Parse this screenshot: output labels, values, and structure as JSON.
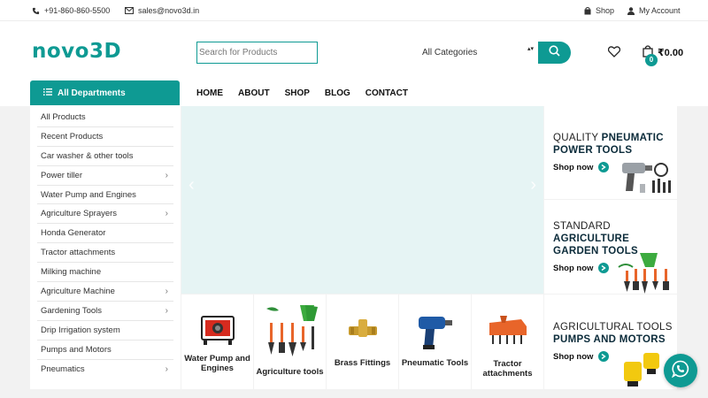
{
  "topbar": {
    "phone": "+91-860-860-5500",
    "email": "sales@novo3d.in",
    "shop_label": "Shop",
    "account_label": "My Account"
  },
  "header": {
    "logo": "novo3D",
    "search_placeholder": "Search for Products",
    "category_selected": "All Categories",
    "cart_count": "0",
    "cart_total": "₹0.00"
  },
  "nav": {
    "departments_label": "All Departments",
    "links": [
      "HOME",
      "ABOUT",
      "SHOP",
      "BLOG",
      "CONTACT"
    ]
  },
  "departments": [
    {
      "label": "All Products",
      "has_sub": false
    },
    {
      "label": "Recent Products",
      "has_sub": false
    },
    {
      "label": "Car washer & other tools",
      "has_sub": false
    },
    {
      "label": "Power tiller",
      "has_sub": true
    },
    {
      "label": "Water Pump and Engines",
      "has_sub": false
    },
    {
      "label": "Agriculture Sprayers",
      "has_sub": true
    },
    {
      "label": "Honda Generator",
      "has_sub": false
    },
    {
      "label": "Tractor attachments",
      "has_sub": false
    },
    {
      "label": "Milking machine",
      "has_sub": false
    },
    {
      "label": "Agriculture Machine",
      "has_sub": true
    },
    {
      "label": "Gardening Tools",
      "has_sub": true
    },
    {
      "label": "Drip Irrigation system",
      "has_sub": false
    },
    {
      "label": "Pumps and Motors",
      "has_sub": false
    },
    {
      "label": "Pneumatics",
      "has_sub": true
    }
  ],
  "categories": [
    {
      "label": "Water Pump and Engines",
      "icon": "water-pump-icon"
    },
    {
      "label": "Agriculture tools",
      "icon": "garden-tools-icon"
    },
    {
      "label": "Brass Fittings",
      "icon": "brass-fitting-icon"
    },
    {
      "label": "Pneumatic Tools",
      "icon": "impact-wrench-icon"
    },
    {
      "label": "Tractor attachments",
      "icon": "rotavator-icon"
    }
  ],
  "promos": [
    {
      "light": "QUALITY ",
      "bold": "PNEUMATIC POWER TOOLS",
      "cta": "Shop now"
    },
    {
      "light": "STANDARD",
      "bold": "AGRICULTURE GARDEN TOOLS",
      "cta": "Shop now"
    },
    {
      "light": "AGRICULTURAL TOOLS",
      "bold": "PUMPS AND MOTORS",
      "cta": "Shop now"
    }
  ],
  "colors": {
    "accent": "#0e9a93",
    "slider_bg": "#e6f4f4",
    "page_bg": "#f2f2f2"
  }
}
